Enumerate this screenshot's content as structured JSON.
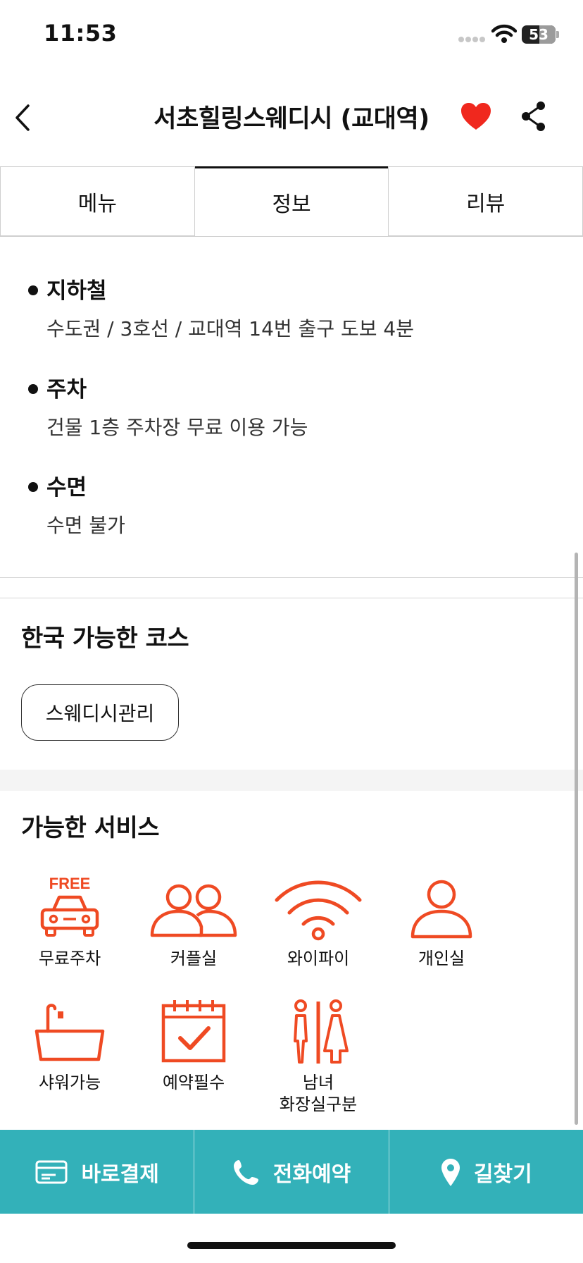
{
  "status_bar": {
    "time": "11:53",
    "battery": "53"
  },
  "header": {
    "title": "서초힐링스웨디시 (교대역)"
  },
  "tabs": [
    {
      "label": "메뉴",
      "active": false
    },
    {
      "label": "정보",
      "active": true
    },
    {
      "label": "리뷰",
      "active": false
    }
  ],
  "info": {
    "items": [
      {
        "label": "지하철",
        "value": "수도권 / 3호선 / 교대역 14번 출구 도보 4분"
      },
      {
        "label": "주차",
        "value": "건물 1층 주차장 무료 이용 가능"
      },
      {
        "label": "수면",
        "value": "수면 불가"
      }
    ]
  },
  "courses": {
    "title": "한국 가능한 코스",
    "chips": [
      "스웨디시관리"
    ]
  },
  "services": {
    "title": "가능한 서비스",
    "items": [
      {
        "icon": "free-parking-icon",
        "label": "무료주차",
        "free_text": "FREE"
      },
      {
        "icon": "couple-room-icon",
        "label": "커플실"
      },
      {
        "icon": "wifi-icon",
        "label": "와이파이"
      },
      {
        "icon": "private-room-icon",
        "label": "개인실"
      },
      {
        "icon": "shower-icon",
        "label": "샤워가능"
      },
      {
        "icon": "reservation-required-icon",
        "label": "예약필수"
      },
      {
        "icon": "gender-restroom-icon",
        "label_line1": "남녀",
        "label_line2": "화장실구분"
      }
    ]
  },
  "actions": [
    {
      "icon": "card-icon",
      "label": "바로결제"
    },
    {
      "icon": "phone-icon",
      "label": "전화예약"
    },
    {
      "icon": "location-pin-icon",
      "label": "길찾기"
    }
  ],
  "colors": {
    "accent": "#ef4a23",
    "heart": "#f0281e",
    "action_bar": "#33b1b9"
  }
}
